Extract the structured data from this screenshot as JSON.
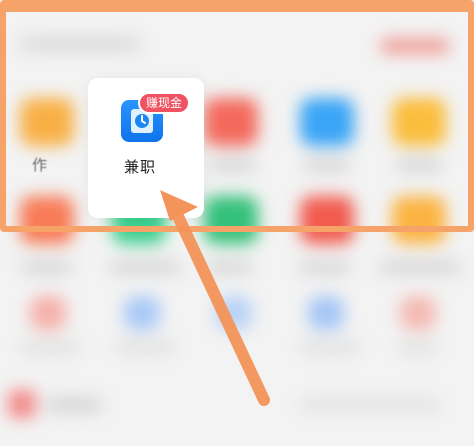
{
  "app_grid": {
    "highlighted_item": {
      "label": "兼职",
      "badge": "赚现金",
      "icon": "clock-icon",
      "icon_color": "#1a86f3"
    },
    "partial_item_label": "作"
  },
  "annotation": {
    "arrow_color": "#f4945a",
    "highlight_color": "#f6a36a"
  }
}
